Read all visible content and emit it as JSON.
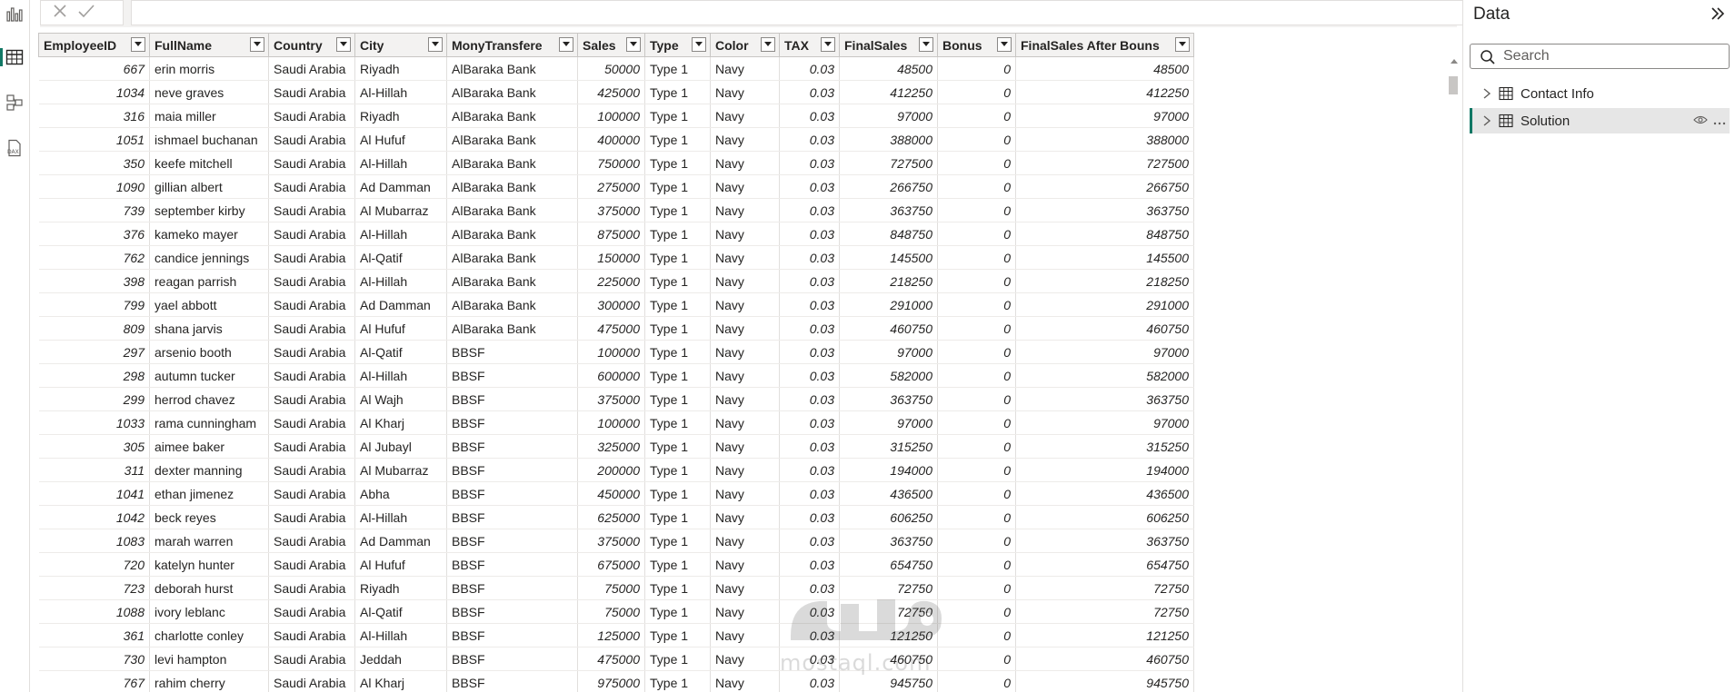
{
  "formula_bar": {
    "cancel_icon": "close-icon",
    "commit_icon": "check-icon",
    "expand_icon": "chevron-down-icon"
  },
  "rail": {
    "items": [
      "report-view-icon",
      "table-view-icon",
      "model-view-icon",
      "dax-query-icon"
    ],
    "dax_label": "DAX",
    "active": "table-view-icon"
  },
  "panel": {
    "title": "Data",
    "search_placeholder": "Search",
    "tables": [
      {
        "name": "Contact Info",
        "selected": false
      },
      {
        "name": "Solution",
        "selected": true
      }
    ]
  },
  "watermark": {
    "text": "mostaql.com"
  },
  "colors": {
    "accent": "#117865",
    "header_bg": "#f3f2f1",
    "border": "#e1dfdd"
  },
  "grid": {
    "columns": [
      "EmployeeID",
      "FullName",
      "Country",
      "City",
      "MonyTransfere",
      "Sales",
      "Type",
      "Color",
      "TAX",
      "FinalSales",
      "Bonus",
      "FinalSales After Bouns"
    ],
    "rows": [
      [
        "667",
        "erin morris",
        "Saudi Arabia",
        "Riyadh",
        "AlBaraka Bank",
        "50000",
        "Type 1",
        "Navy",
        "0.03",
        "48500",
        "0",
        "48500"
      ],
      [
        "1034",
        "neve graves",
        "Saudi Arabia",
        "Al-Hillah",
        "AlBaraka Bank",
        "425000",
        "Type 1",
        "Navy",
        "0.03",
        "412250",
        "0",
        "412250"
      ],
      [
        "316",
        "maia miller",
        "Saudi Arabia",
        "Riyadh",
        "AlBaraka Bank",
        "100000",
        "Type 1",
        "Navy",
        "0.03",
        "97000",
        "0",
        "97000"
      ],
      [
        "1051",
        "ishmael buchanan",
        "Saudi Arabia",
        "Al Hufuf",
        "AlBaraka Bank",
        "400000",
        "Type 1",
        "Navy",
        "0.03",
        "388000",
        "0",
        "388000"
      ],
      [
        "350",
        "keefe mitchell",
        "Saudi Arabia",
        "Al-Hillah",
        "AlBaraka Bank",
        "750000",
        "Type 1",
        "Navy",
        "0.03",
        "727500",
        "0",
        "727500"
      ],
      [
        "1090",
        "gillian albert",
        "Saudi Arabia",
        "Ad Damman",
        "AlBaraka Bank",
        "275000",
        "Type 1",
        "Navy",
        "0.03",
        "266750",
        "0",
        "266750"
      ],
      [
        "739",
        "september kirby",
        "Saudi Arabia",
        "Al Mubarraz",
        "AlBaraka Bank",
        "375000",
        "Type 1",
        "Navy",
        "0.03",
        "363750",
        "0",
        "363750"
      ],
      [
        "376",
        "kameko mayer",
        "Saudi Arabia",
        "Al-Hillah",
        "AlBaraka Bank",
        "875000",
        "Type 1",
        "Navy",
        "0.03",
        "848750",
        "0",
        "848750"
      ],
      [
        "762",
        "candice jennings",
        "Saudi Arabia",
        "Al-Qatif",
        "AlBaraka Bank",
        "150000",
        "Type 1",
        "Navy",
        "0.03",
        "145500",
        "0",
        "145500"
      ],
      [
        "398",
        "reagan parrish",
        "Saudi Arabia",
        "Al-Hillah",
        "AlBaraka Bank",
        "225000",
        "Type 1",
        "Navy",
        "0.03",
        "218250",
        "0",
        "218250"
      ],
      [
        "799",
        "yael abbott",
        "Saudi Arabia",
        "Ad Damman",
        "AlBaraka Bank",
        "300000",
        "Type 1",
        "Navy",
        "0.03",
        "291000",
        "0",
        "291000"
      ],
      [
        "809",
        "shana jarvis",
        "Saudi Arabia",
        "Al Hufuf",
        "AlBaraka Bank",
        "475000",
        "Type 1",
        "Navy",
        "0.03",
        "460750",
        "0",
        "460750"
      ],
      [
        "297",
        "arsenio booth",
        "Saudi Arabia",
        "Al-Qatif",
        "BBSF",
        "100000",
        "Type 1",
        "Navy",
        "0.03",
        "97000",
        "0",
        "97000"
      ],
      [
        "298",
        "autumn tucker",
        "Saudi Arabia",
        "Al-Hillah",
        "BBSF",
        "600000",
        "Type 1",
        "Navy",
        "0.03",
        "582000",
        "0",
        "582000"
      ],
      [
        "299",
        "herrod chavez",
        "Saudi Arabia",
        "Al Wajh",
        "BBSF",
        "375000",
        "Type 1",
        "Navy",
        "0.03",
        "363750",
        "0",
        "363750"
      ],
      [
        "1033",
        "rama cunningham",
        "Saudi Arabia",
        "Al Kharj",
        "BBSF",
        "100000",
        "Type 1",
        "Navy",
        "0.03",
        "97000",
        "0",
        "97000"
      ],
      [
        "305",
        "aimee baker",
        "Saudi Arabia",
        "Al Jubayl",
        "BBSF",
        "325000",
        "Type 1",
        "Navy",
        "0.03",
        "315250",
        "0",
        "315250"
      ],
      [
        "311",
        "dexter manning",
        "Saudi Arabia",
        "Al Mubarraz",
        "BBSF",
        "200000",
        "Type 1",
        "Navy",
        "0.03",
        "194000",
        "0",
        "194000"
      ],
      [
        "1041",
        "ethan jimenez",
        "Saudi Arabia",
        "Abha",
        "BBSF",
        "450000",
        "Type 1",
        "Navy",
        "0.03",
        "436500",
        "0",
        "436500"
      ],
      [
        "1042",
        "beck reyes",
        "Saudi Arabia",
        "Al-Hillah",
        "BBSF",
        "625000",
        "Type 1",
        "Navy",
        "0.03",
        "606250",
        "0",
        "606250"
      ],
      [
        "1083",
        "marah warren",
        "Saudi Arabia",
        "Ad Damman",
        "BBSF",
        "375000",
        "Type 1",
        "Navy",
        "0.03",
        "363750",
        "0",
        "363750"
      ],
      [
        "720",
        "katelyn hunter",
        "Saudi Arabia",
        "Al Hufuf",
        "BBSF",
        "675000",
        "Type 1",
        "Navy",
        "0.03",
        "654750",
        "0",
        "654750"
      ],
      [
        "723",
        "deborah hurst",
        "Saudi Arabia",
        "Riyadh",
        "BBSF",
        "75000",
        "Type 1",
        "Navy",
        "0.03",
        "72750",
        "0",
        "72750"
      ],
      [
        "1088",
        "ivory leblanc",
        "Saudi Arabia",
        "Al-Qatif",
        "BBSF",
        "75000",
        "Type 1",
        "Navy",
        "0.03",
        "72750",
        "0",
        "72750"
      ],
      [
        "361",
        "charlotte conley",
        "Saudi Arabia",
        "Al-Hillah",
        "BBSF",
        "125000",
        "Type 1",
        "Navy",
        "0.03",
        "121250",
        "0",
        "121250"
      ],
      [
        "730",
        "levi hampton",
        "Saudi Arabia",
        "Jeddah",
        "BBSF",
        "475000",
        "Type 1",
        "Navy",
        "0.03",
        "460750",
        "0",
        "460750"
      ],
      [
        "767",
        "rahim cherry",
        "Saudi Arabia",
        "Al Kharj",
        "BBSF",
        "975000",
        "Type 1",
        "Navy",
        "0.03",
        "945750",
        "0",
        "945750"
      ]
    ]
  }
}
